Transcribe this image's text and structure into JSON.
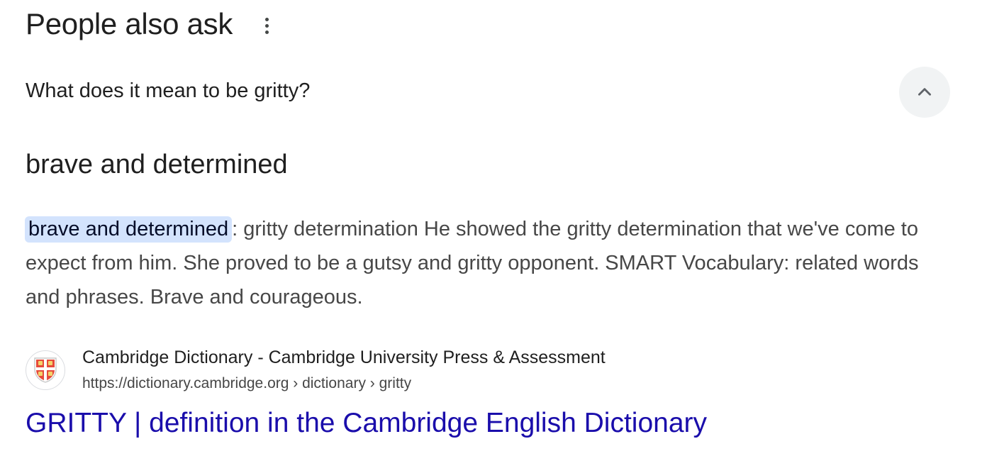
{
  "header": {
    "title": "People also ask",
    "menu_icon": "more-vert-icon"
  },
  "question": {
    "text": "What does it mean to be gritty?",
    "toggle_icon": "chevron-up-icon",
    "expanded": true
  },
  "answer": {
    "heading": "brave and determined",
    "highlight": "brave and determined",
    "snippet_rest": ": gritty determination He showed the gritty determination that we've come to expect from him. She proved to be a gutsy and gritty opponent. SMART Vocabulary: related words and phrases. Brave and courageous."
  },
  "source": {
    "favicon_icon": "cambridge-shield-icon",
    "name": "Cambridge Dictionary - Cambridge University Press & Assessment",
    "url": "https://dictionary.cambridge.org › dictionary › gritty",
    "link_title": "GRITTY | definition in the Cambridge English Dictionary"
  },
  "colors": {
    "link": "#1a0dab",
    "highlight_bg": "#d3e3fd",
    "chevron_bg": "#f1f3f4",
    "text_primary": "#1f1f1f",
    "text_secondary": "#474747"
  }
}
